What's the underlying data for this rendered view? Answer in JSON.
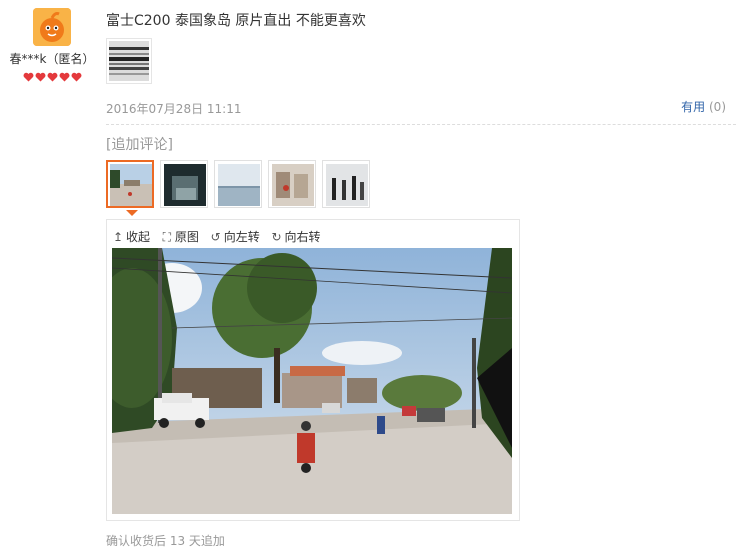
{
  "user": {
    "name": "春***k（匿名）",
    "rank_icons": [
      "heart-icon",
      "heart-icon",
      "heart-icon",
      "heart-icon",
      "heart-icon"
    ],
    "rank_color": "#e4393c"
  },
  "review": {
    "text": "富士C200 泰国象岛 原片直出 不能更喜欢",
    "date": "2016年07月28日 11:11",
    "useful_label": "有用",
    "useful_count": "(0)"
  },
  "append": {
    "label": "[追加评论]",
    "thumbnails": [
      "photo-1",
      "photo-2",
      "photo-3",
      "photo-4",
      "photo-5"
    ],
    "viewer": {
      "collapse_label": "收起",
      "original_label": "原图",
      "rotate_left_label": "向左转",
      "rotate_right_label": "向右转"
    },
    "footer": "确认收货后 13 天追加"
  },
  "colors": {
    "accent": "#ec6a24",
    "link": "#3366aa",
    "muted": "#999999"
  }
}
